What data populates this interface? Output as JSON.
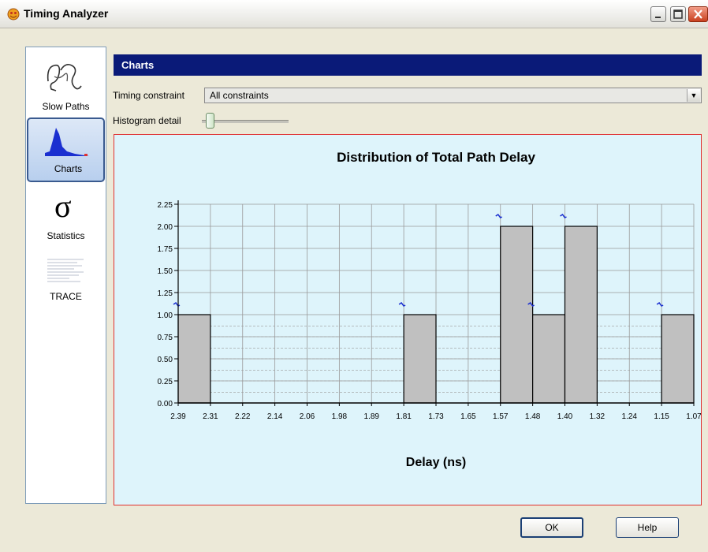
{
  "window": {
    "title": "Timing Analyzer"
  },
  "sidebar": {
    "items": [
      {
        "label": "Slow Paths",
        "icon": "slow-paths-icon",
        "selected": false
      },
      {
        "label": "Charts",
        "icon": "histogram-icon",
        "selected": true
      },
      {
        "label": "Statistics",
        "icon": "sigma-icon",
        "selected": false
      },
      {
        "label": "TRACE",
        "icon": "trace-report-icon",
        "selected": false
      }
    ]
  },
  "header": {
    "title": "Charts"
  },
  "controls": {
    "constraint_label": "Timing constraint",
    "constraint_value": "All constraints",
    "detail_label": "Histogram detail",
    "detail_level": 0.05
  },
  "footer": {
    "ok_label": "OK",
    "help_label": "Help"
  },
  "chart_data": {
    "type": "bar",
    "title": "Distribution of Total Path Delay",
    "xlabel": "Delay (ns)",
    "ylabel": "",
    "ylim": [
      0,
      2.25
    ],
    "yticks": [
      "2.25",
      "2.00",
      "1.75",
      "1.50",
      "1.25",
      "1.00",
      "0.75",
      "0.50",
      "0.25",
      "0.00"
    ],
    "xticks": [
      "2.39",
      "2.31",
      "2.22",
      "2.14",
      "2.06",
      "1.98",
      "1.89",
      "1.81",
      "1.73",
      "1.65",
      "1.57",
      "1.48",
      "1.40",
      "1.32",
      "1.24",
      "1.15",
      "1.07"
    ],
    "bins": [
      {
        "from": "2.39",
        "to": "2.31",
        "value": 1
      },
      {
        "from": "1.81",
        "to": "1.73",
        "value": 1
      },
      {
        "from": "1.57",
        "to": "1.48",
        "value": 2
      },
      {
        "from": "1.48",
        "to": "1.40",
        "value": 1
      },
      {
        "from": "1.40",
        "to": "1.32",
        "value": 2
      },
      {
        "from": "1.15",
        "to": "1.07",
        "value": 1
      }
    ],
    "grid": true,
    "colors": {
      "bar": "#c0c0c0",
      "background": "#def4fb",
      "border": "#e03030"
    }
  }
}
